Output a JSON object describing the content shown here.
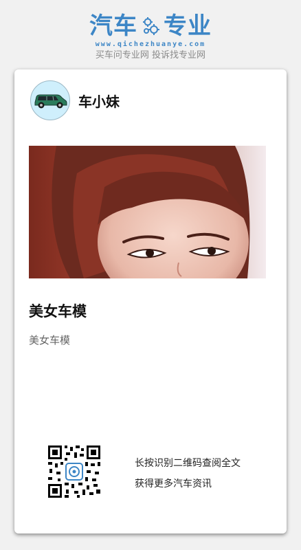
{
  "brand": {
    "logo_left": "汽车",
    "logo_right": "专业",
    "logo_icon": "gears-icon",
    "url": "www.qichezhuanye.com",
    "tagline": "买车问专业网 投诉找专业网"
  },
  "author": {
    "name": "车小妹",
    "avatar_icon": "car-icon"
  },
  "article": {
    "cover_image": "model-portrait-photo",
    "title": "美女车模",
    "summary": "美女车模"
  },
  "share": {
    "qr_icon": "qr-code-icon",
    "line1": "长按识别二维码查阅全文",
    "line2": "获得更多汽车资讯"
  },
  "colors": {
    "brand_blue": "#3d86c6",
    "background": "#f1f1f1",
    "card": "#ffffff"
  }
}
